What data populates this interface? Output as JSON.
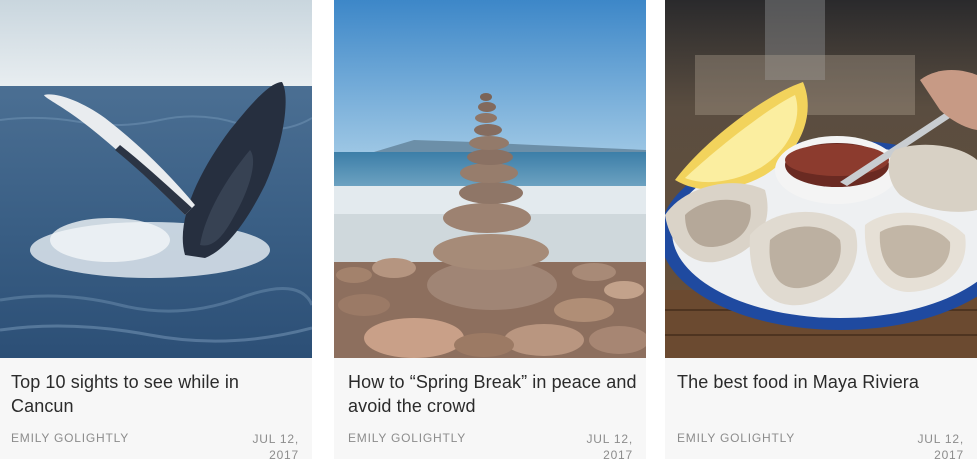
{
  "cards": [
    {
      "title": "Top 10 sights to see while in Cancun",
      "author": "EMILY GOLIGHTLY",
      "date": "JUL 12, 2017",
      "image": "whale-breaching-photo"
    },
    {
      "title": "How to “Spring Break” in peace and avoid the crowd",
      "author": "EMILY GOLIGHTLY",
      "date": "JUL 12, 2017",
      "image": "stacked-stones-beach-photo"
    },
    {
      "title": "The best food in Maya Riviera",
      "author": "EMILY GOLIGHTLY",
      "date": "JUL 12, 2017",
      "image": "oysters-plate-photo"
    }
  ],
  "colors": {
    "card_background": "#f7f7f7",
    "title_text": "#2b2b2b",
    "meta_text": "#8c8c8c"
  }
}
